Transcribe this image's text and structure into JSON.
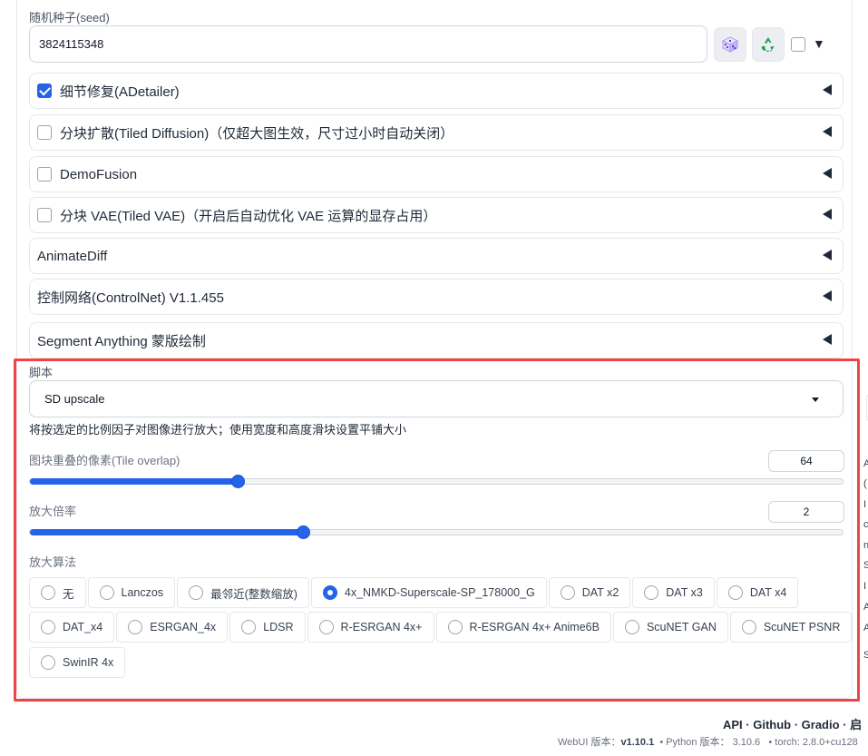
{
  "seed": {
    "label": "随机种子(seed)",
    "value": "3824115348",
    "dice_icon": "dice-icon",
    "recycle_icon": "recycle-icon",
    "colors": {
      "dice": "#c4b5fd",
      "recycle": "#16a34a"
    }
  },
  "accordions": [
    {
      "label": "细节修复(ADetailer)",
      "checkbox": true,
      "checked": true
    },
    {
      "label": "分块扩散(Tiled Diffusion)（仅超大图生效，尺寸过小时自动关闭）",
      "checkbox": true,
      "checked": false
    },
    {
      "label": "DemoFusion",
      "checkbox": true,
      "checked": false
    },
    {
      "label": "分块 VAE(Tiled VAE)（开启后自动优化 VAE 运算的显存占用）",
      "checkbox": true,
      "checked": false
    },
    {
      "label": "AnimateDiff",
      "checkbox": false,
      "checked": false
    },
    {
      "label": "控制网络(ControlNet) V1.1.455",
      "checkbox": false,
      "checked": false
    },
    {
      "label": "Segment Anything 蒙版绘制",
      "checkbox": false,
      "checked": false
    }
  ],
  "script": {
    "label": "脚本",
    "selected": "SD upscale",
    "description": "将按选定的比例因子对图像进行放大；使用宽度和高度滑块设置平铺大小"
  },
  "sliders": {
    "tile_overlap": {
      "label": "图块重叠的像素(Tile overlap)",
      "value": "64",
      "fraction": 0.256
    },
    "scale": {
      "label": "放大倍率",
      "value": "2",
      "fraction": 0.336
    }
  },
  "upscaler": {
    "label": "放大算法",
    "options": [
      [
        "无",
        "Lanczos",
        "最邻近(整数缩放)",
        "4x_NMKD-Superscale-SP_178000_G",
        "DAT x2",
        "DAT x3",
        "DAT x4"
      ],
      [
        "DAT_x4",
        "ESRGAN_4x",
        "LDSR",
        "R-ESRGAN 4x+",
        "R-ESRGAN 4x+ Anime6B",
        "ScuNET GAN",
        "ScuNET PSNR"
      ],
      [
        "SwinIR 4x"
      ]
    ],
    "selected": "4x_NMKD-Superscale-SP_178000_G"
  },
  "footer": {
    "links": "API · Github · Gradio · 启",
    "version_prefix": "WebUI 版本：",
    "webui_version": "v1.10.1",
    "python_prefix": "• Python 版本：",
    "python_version": "3.10.6",
    "torch_prefix": "• torch: 2.8.0+cu128"
  },
  "right_edge_letters": [
    "A",
    "(",
    "I",
    "c",
    "n",
    "S",
    "I",
    "A",
    "A",
    "S"
  ],
  "accent_color": "#2563eb",
  "highlight_color": "#ef4444"
}
